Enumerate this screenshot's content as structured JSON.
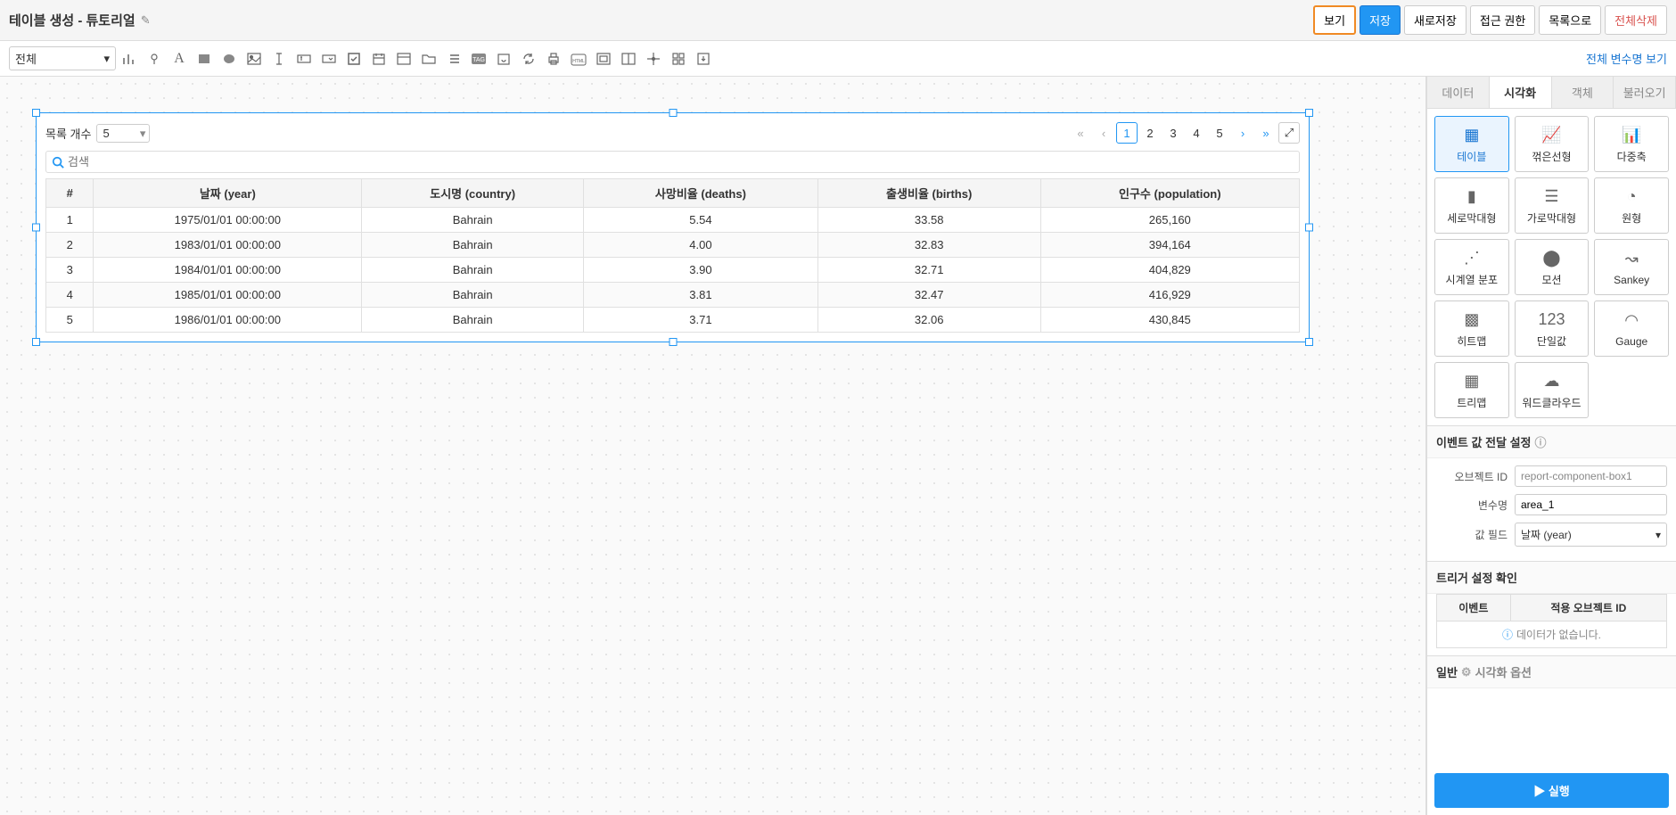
{
  "header": {
    "title": "테이블 생성 - 튜토리얼",
    "buttons": {
      "view": "보기",
      "save": "저장",
      "save_as": "새로저장",
      "permission": "접근 권한",
      "to_list": "목록으로",
      "delete_all": "전체삭제"
    }
  },
  "toolbar": {
    "filter_value": "전체",
    "vars_link": "전체 변수명 보기"
  },
  "component": {
    "list_count_label": "목록 개수",
    "list_count_value": "5",
    "search_placeholder": "검색",
    "pages": [
      "1",
      "2",
      "3",
      "4",
      "5"
    ],
    "current_page": "1",
    "columns": [
      "#",
      "날짜 (year)",
      "도시명 (country)",
      "사망비율 (deaths)",
      "출생비율 (births)",
      "인구수 (population)"
    ],
    "rows": [
      {
        "idx": "1",
        "year": "1975/01/01 00:00:00",
        "country": "Bahrain",
        "deaths": "5.54",
        "births": "33.58",
        "pop": "265,160"
      },
      {
        "idx": "2",
        "year": "1983/01/01 00:00:00",
        "country": "Bahrain",
        "deaths": "4.00",
        "births": "32.83",
        "pop": "394,164"
      },
      {
        "idx": "3",
        "year": "1984/01/01 00:00:00",
        "country": "Bahrain",
        "deaths": "3.90",
        "births": "32.71",
        "pop": "404,829"
      },
      {
        "idx": "4",
        "year": "1985/01/01 00:00:00",
        "country": "Bahrain",
        "deaths": "3.81",
        "births": "32.47",
        "pop": "416,929"
      },
      {
        "idx": "5",
        "year": "1986/01/01 00:00:00",
        "country": "Bahrain",
        "deaths": "3.71",
        "births": "32.06",
        "pop": "430,845"
      }
    ]
  },
  "side": {
    "tabs": {
      "data": "데이터",
      "viz": "시각화",
      "obj": "객체",
      "load": "불러오기"
    },
    "viz_types": [
      {
        "label": "테이블",
        "icon": "table"
      },
      {
        "label": "꺾은선형",
        "icon": "line"
      },
      {
        "label": "다중축",
        "icon": "multiaxis"
      },
      {
        "label": "세로막대형",
        "icon": "vbar"
      },
      {
        "label": "가로막대형",
        "icon": "hbar"
      },
      {
        "label": "원형",
        "icon": "pie"
      },
      {
        "label": "시계열 분포",
        "icon": "scatter"
      },
      {
        "label": "모션",
        "icon": "motion"
      },
      {
        "label": "Sankey",
        "icon": "sankey"
      },
      {
        "label": "히트맵",
        "icon": "heatmap"
      },
      {
        "label": "단일값",
        "icon": "123"
      },
      {
        "label": "Gauge",
        "icon": "gauge"
      },
      {
        "label": "트리맵",
        "icon": "treemap"
      },
      {
        "label": "워드클라우드",
        "icon": "cloud"
      }
    ],
    "event_section": "이벤트 값 전달 설정",
    "form": {
      "object_id_label": "오브젝트 ID",
      "object_id_value": "report-component-box1",
      "var_label": "변수명",
      "var_value": "area_1",
      "field_label": "값 필드",
      "field_value": "날짜 (year)"
    },
    "trigger_section": "트리거 설정 확인",
    "trigger_cols": {
      "event": "이벤트",
      "target": "적용 오브젝트 ID"
    },
    "no_data": "데이터가 없습니다.",
    "general_section": "일반",
    "general_sub": "시각화 옵션",
    "run": "실행"
  }
}
